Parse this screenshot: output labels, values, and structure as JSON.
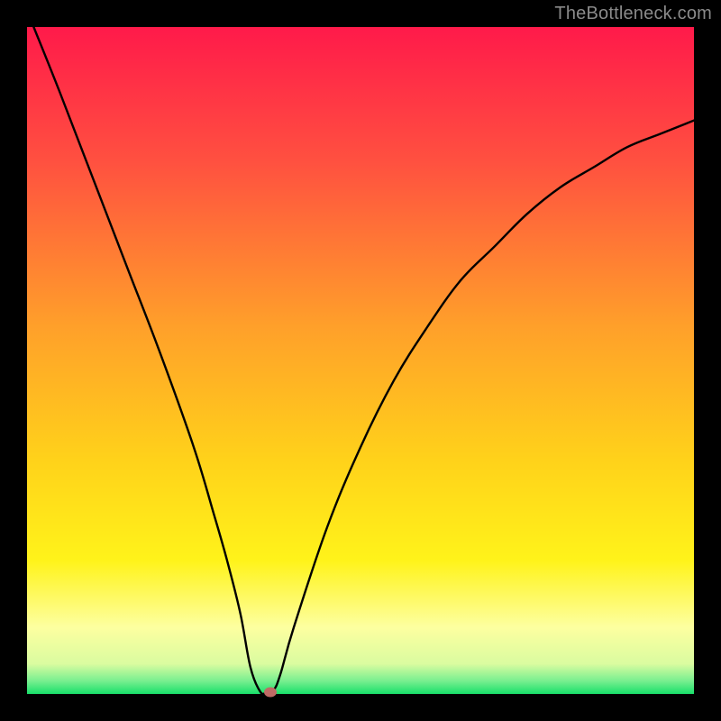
{
  "watermark": "TheBottleneck.com",
  "chart_data": {
    "type": "line",
    "title": "",
    "xlabel": "",
    "ylabel": "",
    "xlim": [
      0,
      100
    ],
    "ylim": [
      0,
      100
    ],
    "grid": false,
    "legend": false,
    "annotations": [],
    "gradient_stops": [
      {
        "offset": 0.0,
        "color": "#ff1a4a"
      },
      {
        "offset": 0.2,
        "color": "#ff5040"
      },
      {
        "offset": 0.45,
        "color": "#ffa02a"
      },
      {
        "offset": 0.65,
        "color": "#ffd21a"
      },
      {
        "offset": 0.8,
        "color": "#fff31a"
      },
      {
        "offset": 0.9,
        "color": "#fdffa0"
      },
      {
        "offset": 0.955,
        "color": "#dafca0"
      },
      {
        "offset": 0.98,
        "color": "#7aef90"
      },
      {
        "offset": 1.0,
        "color": "#18e06a"
      }
    ],
    "series": [
      {
        "name": "curve",
        "x": [
          1,
          5,
          10,
          15,
          20,
          25,
          28,
          30,
          32,
          33.5,
          35,
          36,
          37,
          38,
          40,
          45,
          50,
          55,
          60,
          65,
          70,
          75,
          80,
          85,
          90,
          95,
          100
        ],
        "y": [
          100,
          90,
          77,
          64,
          51,
          37,
          27,
          20,
          12,
          4,
          0.3,
          0.3,
          0.6,
          3,
          10,
          25,
          37,
          47,
          55,
          62,
          67,
          72,
          76,
          79,
          82,
          84,
          86
        ]
      }
    ],
    "flat_segment": {
      "x0": 33.5,
      "x1": 36.5,
      "y": 0.3
    },
    "marker": {
      "x": 36.5,
      "y": 0.3,
      "color": "#bf6a65"
    }
  }
}
